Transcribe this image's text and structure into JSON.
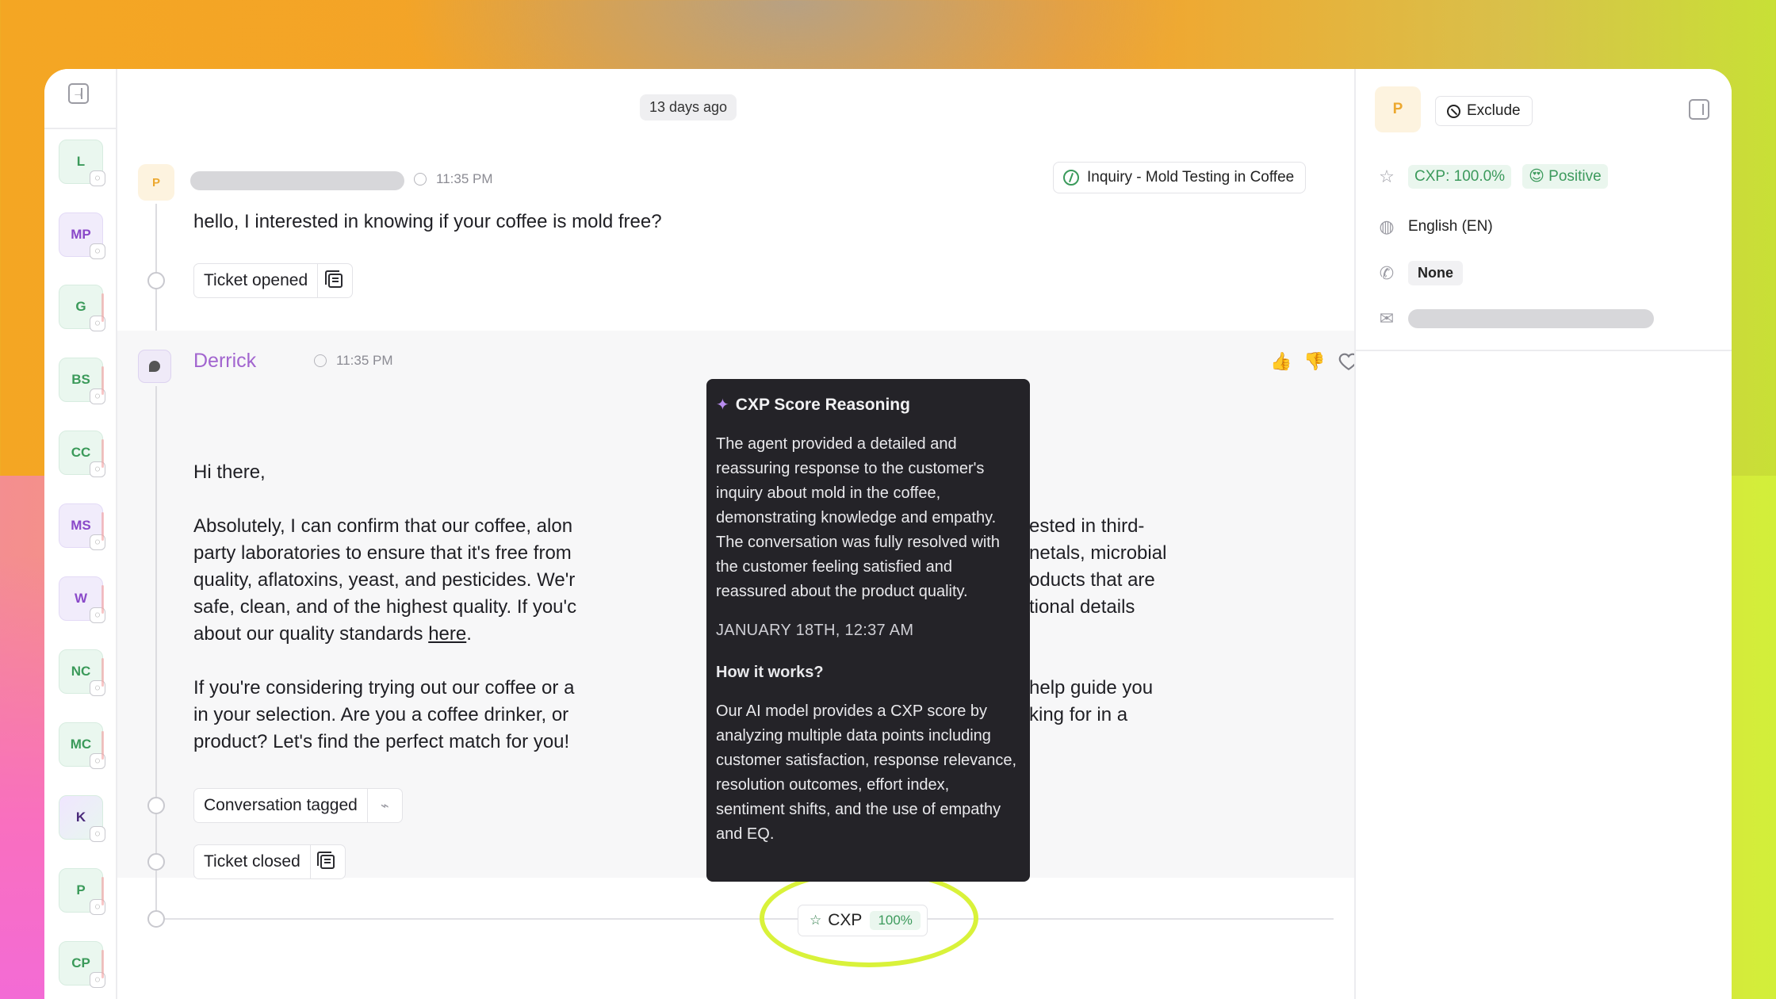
{
  "rail": {
    "avatars": [
      "L",
      "MP",
      "G",
      "BS",
      "CC",
      "MS",
      "W",
      "NC",
      "MC",
      "K",
      "P",
      "CP"
    ]
  },
  "thread": {
    "date_divider": "13 days ago",
    "customer_message": {
      "avatar_initial": "P",
      "time": "11:35 PM",
      "text": "hello, I interested in knowing if your coffee is mold free?"
    },
    "topic_tag": "Inquiry - Mold Testing in Coffee",
    "event_ticket_opened": "Ticket opened",
    "agent_message": {
      "name": "Derrick",
      "time": "11:35 PM",
      "greeting": "Hi there,",
      "para1_line1": "Absolutely, I can confirm that our coffee, alon",
      "para1_line1_tail": "ested in third-",
      "para1_line2": "party laboratories to ensure that it's free from",
      "para1_line2_tail": "netals, microbial",
      "para1_line3": "quality, aflatoxins, yeast, and pesticides. We'r",
      "para1_line3_tail": "oducts that are",
      "para1_line4": "safe, clean, and of the highest quality. If you'c",
      "para1_line4_tail": "tional details",
      "para1_line5_prefix": "about our quality standards ",
      "para1_link": "here",
      "para1_line5_suffix": ".",
      "para2_line1": "If you're considering trying out our coffee or a",
      "para2_line1_tail": "help guide you",
      "para2_line2": "in your selection. Are you a coffee drinker, or",
      "para2_line2_tail": "king for in a",
      "para2_line3": "product? Let's find the perfect match for you!"
    },
    "event_conversation_tagged": "Conversation tagged",
    "event_ticket_closed": "Ticket closed",
    "cxp_pill": {
      "label": "CXP",
      "value": "100%"
    }
  },
  "tooltip": {
    "title": "CXP Score Reasoning",
    "reasoning": "The agent provided a detailed and reassuring response to the customer's inquiry about mold in the coffee, demonstrating knowledge and empathy. The conversation was fully resolved with the customer feeling satisfied and reassured about the product quality.",
    "timestamp": "JANUARY 18TH, 12:37 AM",
    "how_title": "How it works?",
    "how_body": "Our AI model provides a CXP score by analyzing multiple data points including customer satisfaction, response relevance, resolution outcomes, effort index, sentiment shifts, and the use of empathy and EQ."
  },
  "right_panel": {
    "avatar_initial": "P",
    "exclude_label": "Exclude",
    "cxp_badge": "CXP: 100.0%",
    "sentiment_badge": "😍 Positive",
    "language": "English (EN)",
    "phone": "None"
  },
  "colors": {
    "accent_green": "#3c9a5c",
    "agent_name": "#a265cf",
    "highlight_ring": "#d9f23a"
  }
}
